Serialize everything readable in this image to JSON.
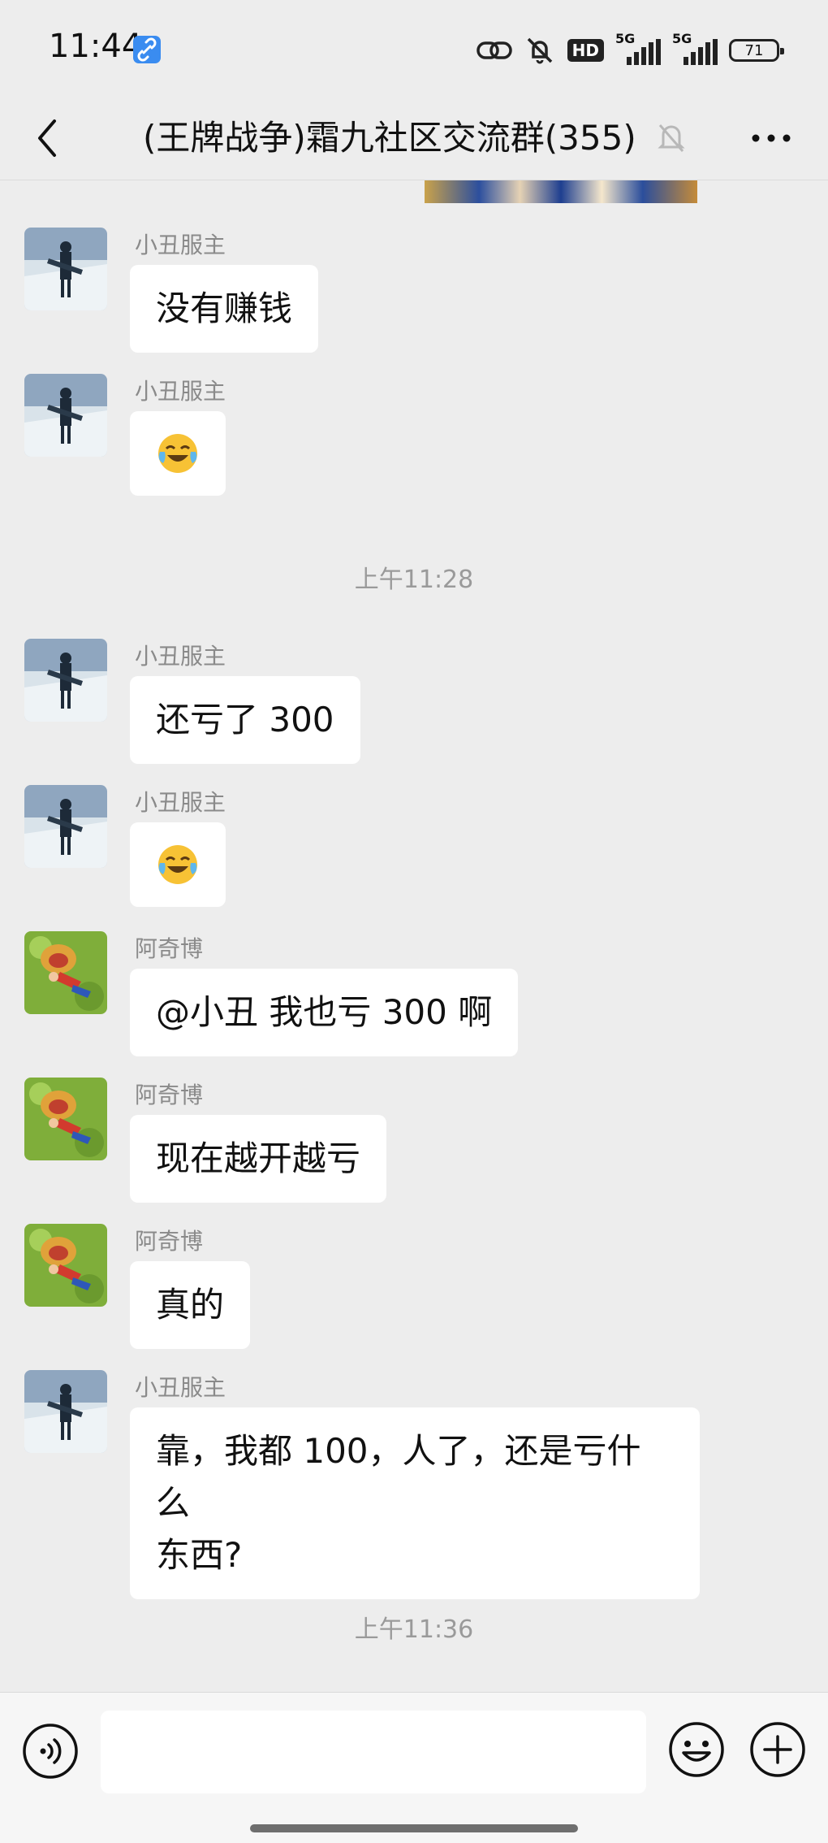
{
  "status_bar": {
    "time": "11:44",
    "hd_label": "HD",
    "net1_label": "5G",
    "net2_label": "5G",
    "battery": "71"
  },
  "nav": {
    "title": "(王牌战争)霜九社区交流群(355)"
  },
  "icons": {
    "back": "chevron-left-icon",
    "mute": "bell-off-icon",
    "more": "more-dots-icon",
    "voice": "voice-icon",
    "emoji": "smiley-icon",
    "plus": "plus-icon"
  },
  "messages": [
    {
      "sender": "小丑服主",
      "text": "没有赚钱",
      "avatar": "traveler-avatar"
    },
    {
      "sender": "小丑服主",
      "emoji": "crying-laughing",
      "avatar": "traveler-avatar"
    },
    {
      "timestamp": "上午11:28"
    },
    {
      "sender": "小丑服主",
      "text": "还亏了 300",
      "avatar": "traveler-avatar"
    },
    {
      "sender": "小丑服主",
      "emoji": "crying-laughing",
      "avatar": "traveler-avatar"
    },
    {
      "sender": "阿奇博",
      "text": "@小丑  我也亏 300 啊",
      "avatar": "straw-hat-avatar"
    },
    {
      "sender": "阿奇博",
      "text": "现在越开越亏",
      "avatar": "straw-hat-avatar"
    },
    {
      "sender": "阿奇博",
      "text": "真的",
      "avatar": "straw-hat-avatar"
    },
    {
      "sender": "小丑服主",
      "text_line1": "靠，我都 100，人了，还是亏什么",
      "text_line2": "东西?",
      "avatar": "traveler-avatar"
    },
    {
      "timestamp": "上午11:36"
    }
  ],
  "input": {
    "placeholder": ""
  }
}
